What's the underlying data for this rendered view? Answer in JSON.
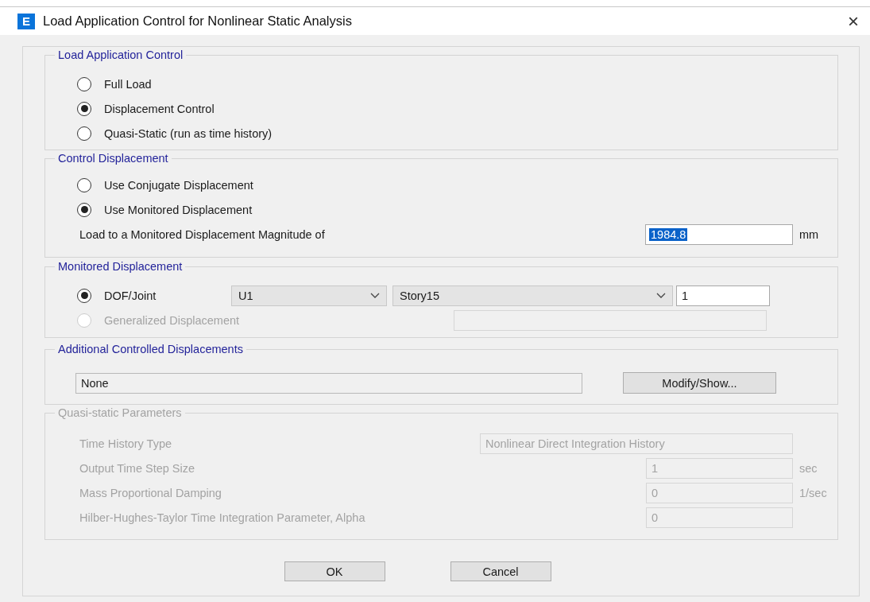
{
  "window": {
    "app_badge": "E",
    "title": "Load Application Control for Nonlinear Static Analysis",
    "close": "×"
  },
  "load_application_control": {
    "title": "Load Application Control",
    "options": [
      {
        "label": "Full Load",
        "selected": false
      },
      {
        "label": "Displacement Control",
        "selected": true
      },
      {
        "label": "Quasi-Static (run as time history)",
        "selected": false
      }
    ]
  },
  "control_displacement": {
    "title": "Control Displacement",
    "options": [
      {
        "label": "Use Conjugate Displacement",
        "selected": false
      },
      {
        "label": "Use Monitored Displacement",
        "selected": true
      }
    ],
    "magnitude": {
      "label": "Load to a Monitored Displacement Magnitude of",
      "value": "1984.8",
      "highlighted": true,
      "unit": "mm"
    }
  },
  "monitored_displacement": {
    "title": "Monitored Displacement",
    "options": [
      {
        "label": "DOF/Joint",
        "selected": true,
        "disabled": false
      },
      {
        "label": "Generalized Displacement",
        "selected": false,
        "disabled": true
      }
    ],
    "dof": "U1",
    "joint": "Story15",
    "joint_number": "1"
  },
  "additional_controlled_displacements": {
    "title": "Additional Controlled Displacements",
    "value": "None",
    "button": "Modify/Show..."
  },
  "quasi_static_parameters": {
    "title": "Quasi-static Parameters",
    "disabled": true,
    "rows": [
      {
        "label": "Time History Type",
        "value": "Nonlinear Direct Integration History",
        "kind": "wide"
      },
      {
        "label": "Output Time Step Size",
        "value": "1",
        "unit": "sec",
        "kind": "narrow"
      },
      {
        "label": "Mass Proportional Damping",
        "value": "0",
        "unit": "1/sec",
        "kind": "narrow"
      },
      {
        "label": "Hilber-Hughes-Taylor Time Integration Parameter, Alpha",
        "value": "0",
        "kind": "narrow"
      }
    ]
  },
  "buttons": [
    {
      "label": "OK"
    },
    {
      "label": "Cancel"
    }
  ]
}
